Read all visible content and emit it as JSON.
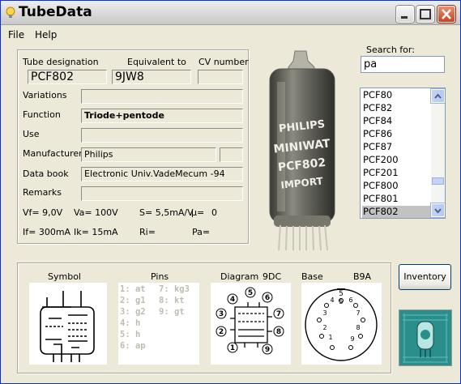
{
  "window": {
    "title": "TubeData"
  },
  "menu": [
    {
      "label": "File"
    },
    {
      "label": "Help"
    }
  ],
  "form": {
    "tube_designation_label": "Tube designation",
    "tube_designation": "PCF802",
    "equivalent_label": "Equivalent to",
    "equivalent": "9JW8",
    "cv_label": "CV number",
    "cv": "",
    "variations_label": "Variations",
    "variations": "",
    "function_label": "Function",
    "function": "Triode+pentode",
    "use_label": "Use",
    "use": "",
    "manufacturer_label": "Manufacturer",
    "manufacturer": "Philips",
    "manufacturer_extra": "",
    "databook_label": "Data book",
    "databook": "Electronic Univ.VadeMecum -94",
    "remarks_label": "Remarks",
    "remarks": ""
  },
  "specs": {
    "vf": "Vf= 9,0V",
    "va": "Va= 100V",
    "s": "S= 5,5mA/V",
    "mu": "µ=",
    "mu_val": "0",
    "if": "If= 300mA",
    "ik": "Ik= 15mA",
    "ri": "Ri=",
    "pa": "Pa="
  },
  "search": {
    "label": "Search for:",
    "value": "pa"
  },
  "tube_list": [
    "PCF80",
    "PCF82",
    "PCF84",
    "PCF86",
    "PCF87",
    "PCF200",
    "PCF201",
    "PCF800",
    "PCF801",
    "PCF802"
  ],
  "selected_tube": "PCF802",
  "photo_text": {
    "line1": "PHILIPS",
    "line2": "MINIWAT",
    "line3": "PCF802",
    "line4": "IMPORT"
  },
  "bottom": {
    "symbol_label": "Symbol",
    "pins_label": "Pins",
    "diagram_label": "Diagram",
    "diagram_code": "9DC",
    "base_label": "Base",
    "base_code": "B9A",
    "pins_left": [
      "1: at",
      "2: g1",
      "3: g2",
      "4: h",
      "5: h",
      "6: ap"
    ],
    "pins_right": [
      "7: kg3",
      "8: kt",
      "9: gt"
    ],
    "diagram_pins": [
      "1",
      "2",
      "3",
      "4",
      "5",
      "6",
      "7",
      "8",
      "9"
    ],
    "base_pins": [
      "1",
      "2",
      "3",
      "4",
      "5",
      "6",
      "7",
      "8",
      "9"
    ],
    "base_top": "5"
  },
  "inventory_button": "Inventory"
}
